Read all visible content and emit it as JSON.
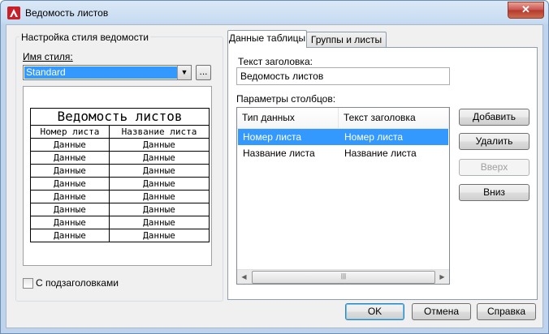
{
  "window": {
    "title": "Ведомость листов",
    "close_glyph": "✕"
  },
  "left": {
    "group_title": "Настройка стиля ведомости",
    "style_label": "Имя стиля:",
    "style_value": "Standard",
    "browse_label": "...",
    "preview": {
      "title": "Ведомость листов",
      "headers": [
        "Номер листа",
        "Название листа"
      ],
      "rows": [
        [
          "Данные",
          "Данные"
        ],
        [
          "Данные",
          "Данные"
        ],
        [
          "Данные",
          "Данные"
        ],
        [
          "Данные",
          "Данные"
        ],
        [
          "Данные",
          "Данные"
        ],
        [
          "Данные",
          "Данные"
        ],
        [
          "Данные",
          "Данные"
        ],
        [
          "Данные",
          "Данные"
        ]
      ]
    },
    "subheaders_checkbox": {
      "label": "С подзаголовками",
      "checked": false
    }
  },
  "tabs": [
    {
      "label": "Данные таблицы",
      "active": true
    },
    {
      "label": "Группы и листы",
      "active": false
    }
  ],
  "table_tab": {
    "header_text_label": "Текст заголовка:",
    "header_text_value": "Ведомость листов",
    "columns_label": "Параметры столбцов:",
    "columns_headers": [
      "Тип данных",
      "Текст заголовка"
    ],
    "columns_rows": [
      {
        "type": "Номер листа",
        "header": "Номер листа",
        "selected": true
      },
      {
        "type": "Название листа",
        "header": "Название листа",
        "selected": false
      }
    ]
  },
  "side_buttons": {
    "add": "Добавить",
    "remove": "Удалить",
    "up": "Вверх",
    "down": "Вниз"
  },
  "footer_buttons": {
    "ok": "OK",
    "cancel": "Отмена",
    "help": "Справка"
  },
  "colors": {
    "selection": "#3399ff",
    "dialog_bg": "#f0f0f0",
    "close_button": "#c75050"
  }
}
